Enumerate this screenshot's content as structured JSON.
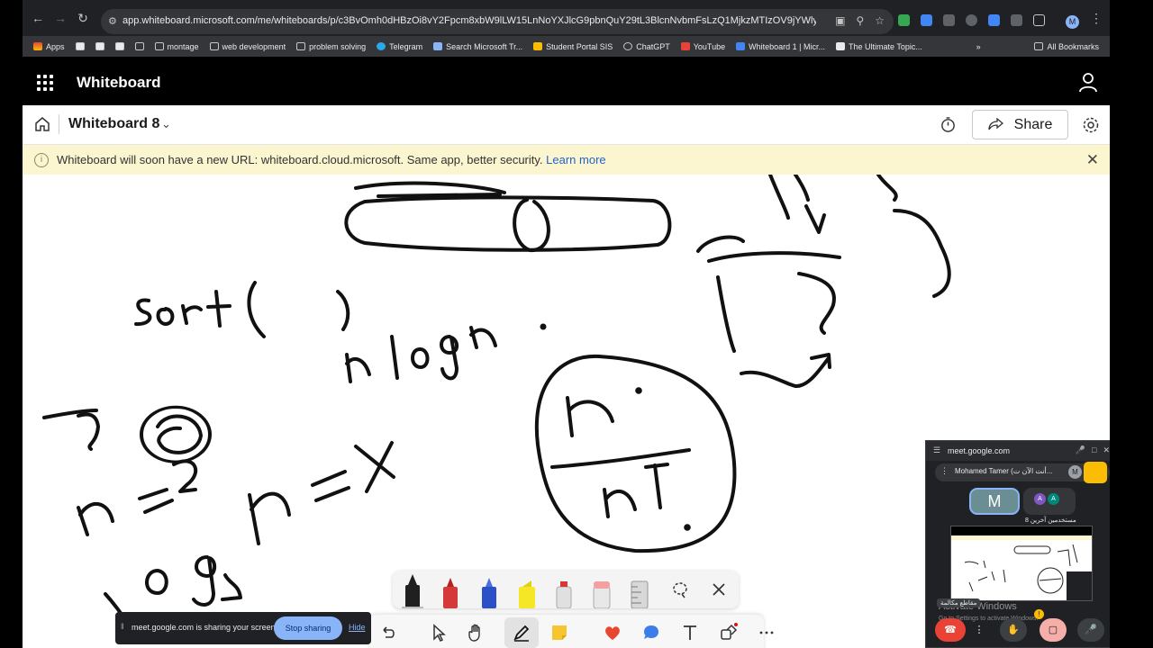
{
  "browser": {
    "url": "app.whiteboard.microsoft.com/me/whiteboards/p/c3BvOmh0dHBzOi8vY2Fpcm8xbW9lLW15LnNoYXJlcG9pbnQuY29tL3BlcnNvbmFsLzQ1MjkzMTIzOV9jYWlybzFfbW9lX2VkdV...",
    "avatar_letter": "M",
    "bookmarks": [
      "Apps",
      "montage",
      "web development",
      "problem solving",
      "Telegram",
      "Search Microsoft Tr...",
      "Student Portal SIS",
      "ChatGPT",
      "YouTube",
      "Whiteboard 1 | Micr...",
      "The Ultimate Topic..."
    ],
    "bookmarks_right": "All Bookmarks",
    "overflow": "»"
  },
  "app": {
    "name": "Whiteboard",
    "board_title": "Whiteboard 8",
    "share_label": "Share"
  },
  "banner": {
    "text": "Whiteboard will soon have a new URL: whiteboard.cloud.microsoft. Same app, better security.",
    "link": "Learn more"
  },
  "sharebar": {
    "text": "meet.google.com is sharing your screen.",
    "stop_label": "Stop sharing",
    "hide_label": "Hide"
  },
  "pip": {
    "url": "meet.google.com",
    "name": "Mohamed Tamer (أنت الآن ت...",
    "chip_letter": "M",
    "tile_letter": "M",
    "others_letters": [
      "A",
      "A"
    ],
    "others_label": "8 مستخدمين آخرين",
    "watermark_title": "Activate Windows",
    "watermark_sub": "Go to Settings to activate Windows.",
    "caption_bubble": "مقاطع مكالمة"
  },
  "colors": {
    "accent": "#2563c9",
    "banner_bg": "#fbf5d0",
    "meet_blue": "#8ab4f8",
    "leave_red": "#ea4335"
  },
  "icons": [
    "home-icon",
    "chevron-down-icon",
    "timer-icon",
    "share-icon",
    "gear-icon",
    "info-icon",
    "close-icon",
    "waffle-icon",
    "user-icon",
    "lasso-icon",
    "undo-icon",
    "select-icon",
    "hand-icon",
    "pen-icon",
    "sticky-note-icon",
    "reaction-icon",
    "comment-icon",
    "text-icon",
    "shapes-icon",
    "more-icon"
  ]
}
